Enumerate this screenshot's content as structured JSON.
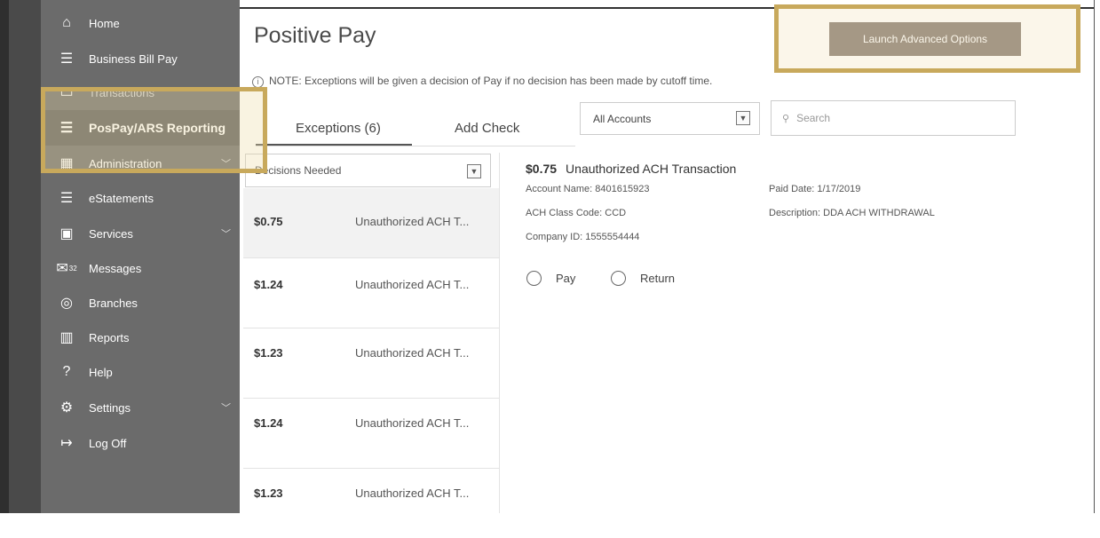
{
  "sidebar": {
    "items": [
      {
        "label": "Home",
        "icon": "home-icon"
      },
      {
        "label": "Business Bill Pay",
        "icon": "list-icon"
      },
      {
        "label": "Transactions",
        "icon": "card-icon"
      },
      {
        "label": "PosPay/ARS Reporting",
        "icon": "list-icon"
      },
      {
        "label": "Administration",
        "icon": "building-icon"
      },
      {
        "label": "eStatements",
        "icon": "list-icon"
      },
      {
        "label": "Services",
        "icon": "calculator-icon"
      },
      {
        "label": "Messages",
        "icon": "mail-icon",
        "badge": "32"
      },
      {
        "label": "Branches",
        "icon": "location-icon"
      },
      {
        "label": "Reports",
        "icon": "chart-icon"
      },
      {
        "label": "Help",
        "icon": "help-icon"
      },
      {
        "label": "Settings",
        "icon": "gear-icon"
      },
      {
        "label": "Log Off",
        "icon": "logout-icon"
      }
    ]
  },
  "page": {
    "title": "Positive Pay",
    "note": "NOTE: Exceptions will be given a decision of Pay if no decision has been made by cutoff time.",
    "launch_label": "Launch Advanced Options"
  },
  "tabs": [
    {
      "label": "Exceptions (6)"
    },
    {
      "label": "Add Check"
    }
  ],
  "account_select": {
    "value": "All Accounts"
  },
  "search": {
    "placeholder": "Search"
  },
  "filter": {
    "value": "Decisions Needed"
  },
  "exceptions": [
    {
      "amount": "$0.75",
      "description": "Unauthorized ACH T..."
    },
    {
      "amount": "$1.24",
      "description": "Unauthorized ACH T..."
    },
    {
      "amount": "$1.23",
      "description": "Unauthorized ACH T..."
    },
    {
      "amount": "$1.24",
      "description": "Unauthorized ACH T..."
    },
    {
      "amount": "$1.23",
      "description": "Unauthorized ACH T..."
    }
  ],
  "detail": {
    "amount": "$0.75",
    "title": "Unauthorized ACH Transaction",
    "account_name": "Account Name: 8401615923",
    "paid_date": "Paid Date: 1/17/2019",
    "class_code": "ACH Class Code: CCD",
    "description": "Description: DDA ACH WITHDRAWAL",
    "company_id": "Company ID: 1555554444",
    "pay_label": "Pay",
    "return_label": "Return"
  },
  "colors": {
    "sidebar": "#6b6b6b",
    "highlight": "#c8a95c",
    "button": "#8c8279"
  }
}
